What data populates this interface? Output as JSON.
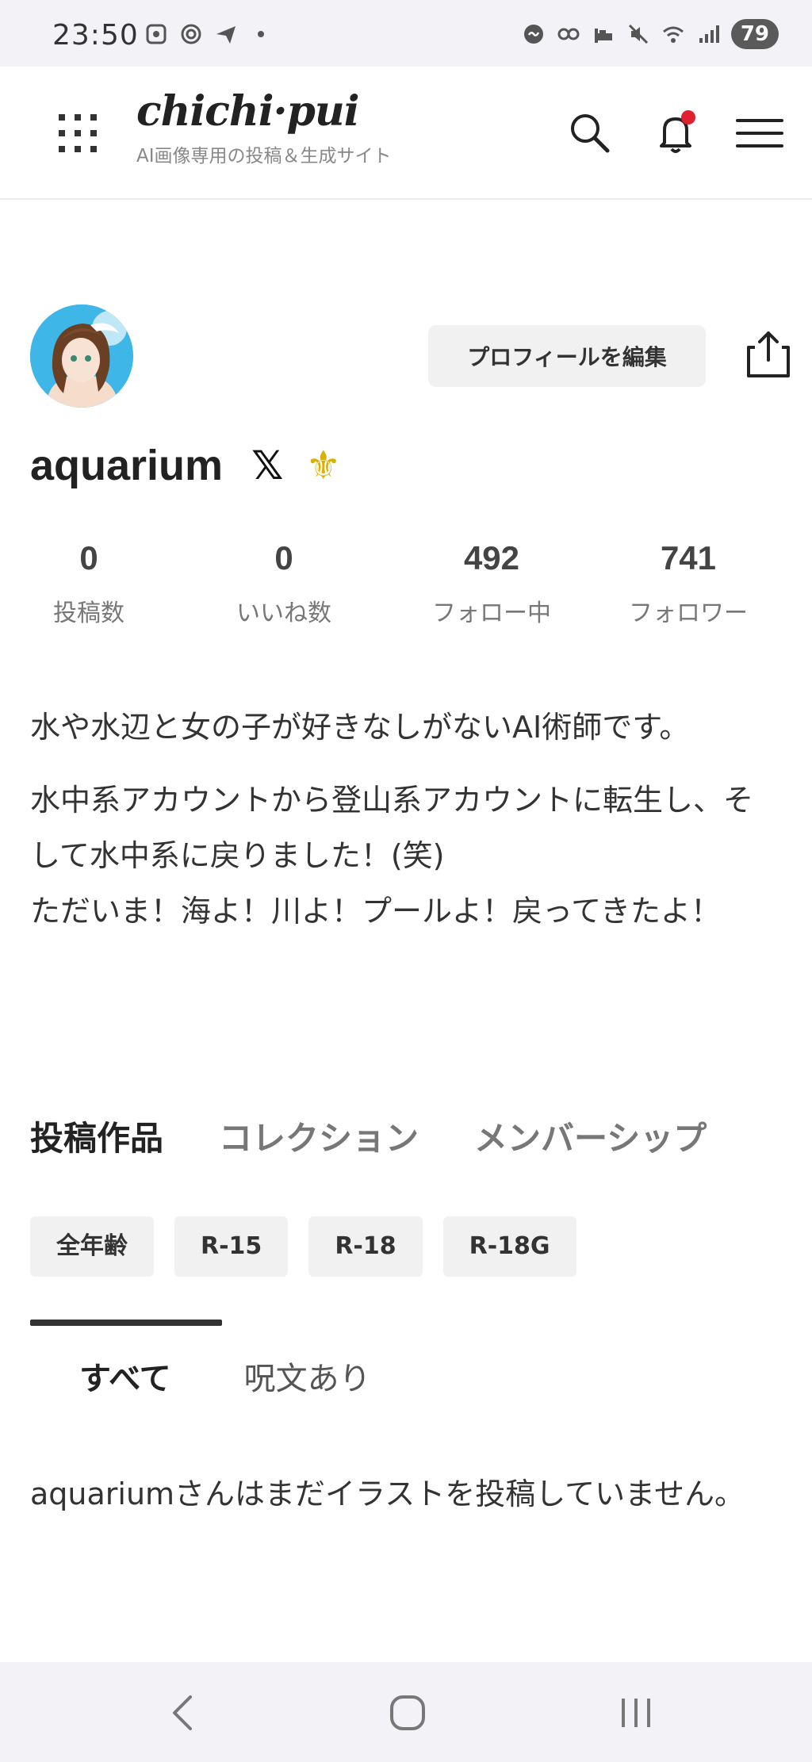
{
  "status_bar": {
    "time": "23:50",
    "battery": "79",
    "left_icons": [
      "screenshot-icon",
      "radar-icon",
      "send-icon",
      "dot-icon"
    ],
    "right_icons": [
      "chat-bubble-icon",
      "link-icon",
      "sleep-icon",
      "mute-icon",
      "wifi-icon",
      "signal-icon"
    ]
  },
  "header": {
    "logo": "chichi·pui",
    "tagline": "AI画像専用の投稿＆生成サイト"
  },
  "profile": {
    "edit_button": "プロフィールを編集",
    "username": "aquarium",
    "x_icon_glyph": "𝕏",
    "badge_glyph": "⚜"
  },
  "stats": [
    {
      "value": "0",
      "label": "投稿数"
    },
    {
      "value": "0",
      "label": "いいね数"
    },
    {
      "value": "492",
      "label": "フォロー中"
    },
    {
      "value": "741",
      "label": "フォロワー"
    }
  ],
  "bio": {
    "line1": "水や水辺と女の子が好きなしがないAI術師です。",
    "line2": "水中系アカウントから登山系アカウントに転生し、そして水中系に戻りました！(笑)",
    "line3": "ただいま！海よ！川よ！プールよ！戻ってきたよ！"
  },
  "tabs": [
    "投稿作品",
    "コレクション",
    "メンバーシップ"
  ],
  "chips": [
    "全年齢",
    "R-15",
    "R-18",
    "R-18G"
  ],
  "subtabs": [
    "すべて",
    "呪文あり"
  ],
  "empty_message": "aquariumさんはまだイラストを投稿していません。",
  "colors": {
    "accent": "#e0202e",
    "badge": "#d9b100",
    "chip_bg": "#f1f1f1"
  }
}
